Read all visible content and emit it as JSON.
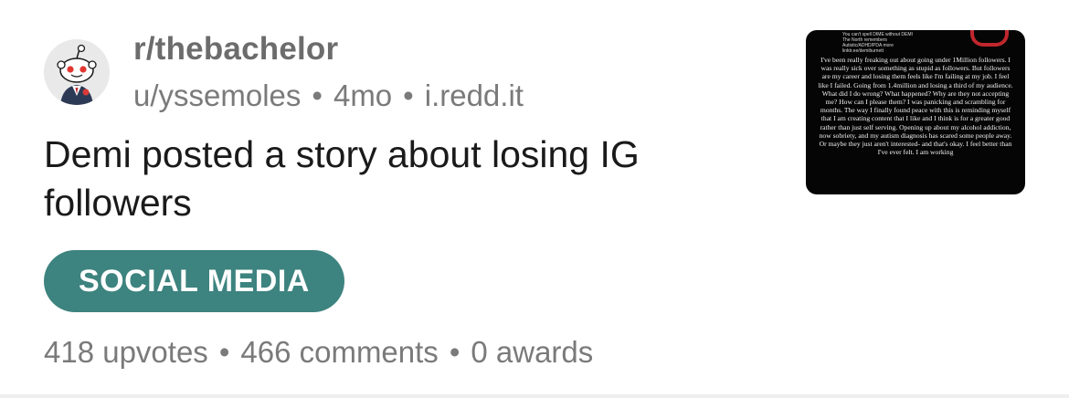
{
  "post": {
    "subreddit": "r/thebachelor",
    "author": "u/yssemoles",
    "age": "4mo",
    "domain": "i.redd.it",
    "separator": "•",
    "title": "Demi posted a story about losing IG followers",
    "flair": "SOCIAL MEDIA",
    "flair_color": "#3d837f",
    "upvotes": "418 upvotes",
    "comments": "466 comments",
    "awards": "0 awards",
    "avatar_icon": "reddit-snoo-avatar-icon",
    "thumbnail": {
      "top_lines": [
        "You can't spell DIME without DEMI",
        "The North remembers",
        "Autistic/ADHD/PDA   more",
        "linktr.ee/demiburnett"
      ],
      "story_text": "I've been really freaking out about going under 1Million followers. I was really sick over something as stupid as followers. But followers are my career and losing them feels like I'm failing at my job. I feel like I failed. Going from 1.4million and losing a third of my audience. What did I do wrong? What happened? Why are they not accepting me? How can I please them? I was panicking and scrambling for months. The way I finally found peace with this is reminding myself that I am creating content that I like and I think is for a greater good rather than just self serving. Opening up about my alcohol addiction, now sobriety, and my autism diagnosis has scared some people away. Or maybe they just aren't interested- and that's okay. I feel better than I've ever felt. I am working"
    }
  }
}
